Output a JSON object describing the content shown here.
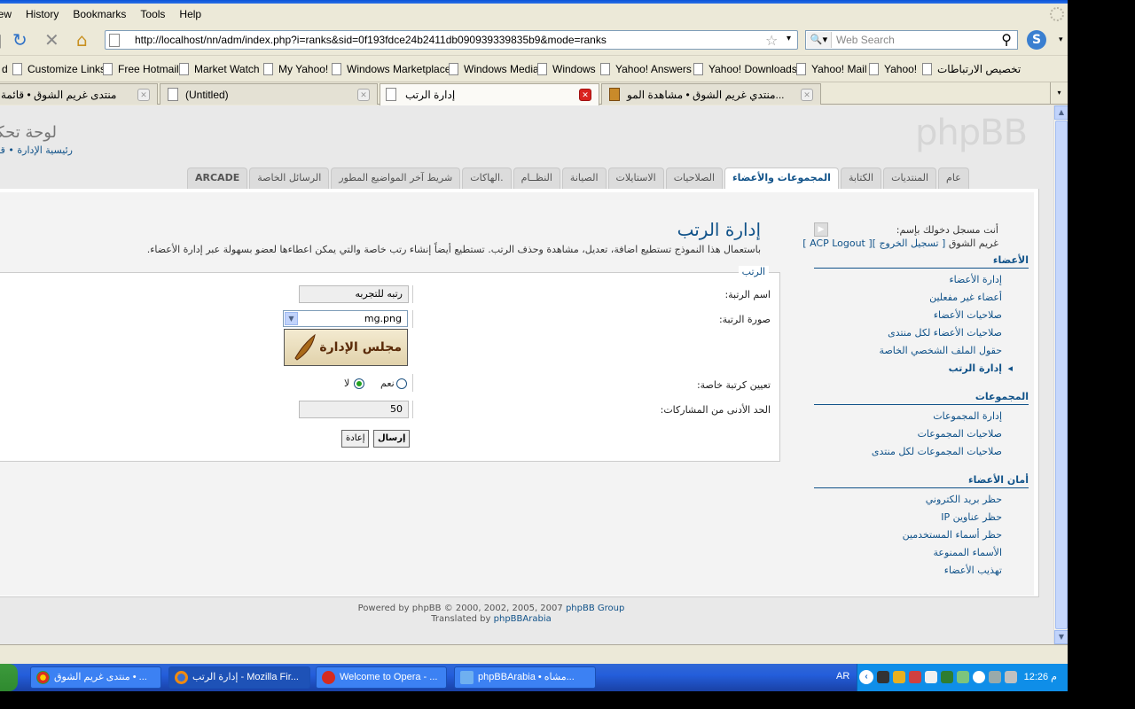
{
  "browser": {
    "menu": [
      "View",
      "History",
      "Bookmarks",
      "Tools",
      "Help"
    ],
    "menu_display": [
      "iew",
      "History",
      "Bookmarks",
      "Tools",
      "Help"
    ],
    "url": "http://localhost/nn/adm/index.php?i=ranks&sid=0f193fdce24b2411db090939339835b9&mode=ranks",
    "search_placeholder": "Web Search",
    "bookmarks": [
      "d",
      "Customize Links",
      "Free Hotmail",
      "Market Watch",
      "My Yahoo!",
      "Windows Marketplace",
      "Windows Media",
      "Windows",
      "Yahoo! Answers",
      "Yahoo! Downloads",
      "Yahoo! Mail",
      "Yahoo!",
      "تخصيص الارتباطات"
    ],
    "tabs": [
      {
        "label": "منتدى غريم الشوق • قائمة"
      },
      {
        "label": "(Untitled)"
      },
      {
        "label": "إدارة الرتب"
      },
      {
        "label": "منتدي غريم الشوق • مشاهدة المو..."
      }
    ]
  },
  "acp": {
    "logo": "phpBB",
    "title": "لوحة تحكم",
    "breadcrumb": "رئيسية الإدارة • قا",
    "tabs": [
      "عام",
      "المنتديات",
      "الكتابة",
      "المجموعات والأعضاء",
      "الصلاحيات",
      "الاستايلات",
      "الصيانة",
      "النظــام",
      "الهاكات.",
      "شريط آخر المواضيع المطور",
      "الرسائل الخاصة",
      "ARCADE"
    ],
    "active_tab_index": 3
  },
  "sidebar": {
    "logged_in_as": "أنت مسجل دخولك بإسم:",
    "user": "غريم الشوق",
    "logout": "[ تسجيل الخروج ][ ACP Logout ]",
    "sections": [
      {
        "title": "الأعضاء",
        "links": [
          "إدارة الأعضاء",
          "أعضاء غير مفعلين",
          "صلاحيات الأعضاء",
          "صلاحيات الأعضاء لكل منتدى",
          "حقول الملف الشخصي الخاصة",
          "إدارة الرتب"
        ]
      },
      {
        "title": "المجموعات",
        "links": [
          "إدارة المجموعات",
          "صلاحيات المجموعات",
          "صلاحيات المجموعات لكل منتدى"
        ]
      },
      {
        "title": "أمان الأعضاء",
        "links": [
          "حظر بريد الكتروني",
          "حظر عناوين IP",
          "حظر أسماء المستخدمين",
          "الأسماء الممنوعة",
          "تهذيب الأعضاء"
        ]
      }
    ]
  },
  "main": {
    "title": "إدارة الرتب",
    "description": "باستعمال هذا النموذج تستطيع اضافة، تعديل، مشاهدة وحذف الرتب. تستطيع أيضاً إنشاء رتب خاصة والتي يمكن اعطاءها لعضو بسهولة عبر إدارة الأعضاء.",
    "legend": "الرتب",
    "rank_title_label": "اسم الرتبة:",
    "rank_title_value": "رتبه للتجربه",
    "rank_image_label": "صورة الرتبة:",
    "rank_image_value": "mg.png",
    "rank_image_text": "مجلس الإدارة",
    "special_label": "تعيين كرتبة خاصة:",
    "yes": "نعم",
    "no": "لا",
    "special_selected": "no",
    "min_posts_label": "الحد الأدنى من المشاركات:",
    "min_posts_value": "50",
    "submit": "إرسال",
    "reset": "إعادة"
  },
  "footer": {
    "powered": "Powered by phpBB © 2000, 2002, 2005, 2007",
    "group": "phpBB Group",
    "translated": "Translated by",
    "arabia": "phpBBArabia"
  },
  "taskbar": {
    "items": [
      "منتدى غريم الشوق • ...",
      "إدارة الرتب - Mozilla Fir...",
      "Welcome to Opera - ...",
      "phpBBArabia • مشاه..."
    ],
    "lang": "AR",
    "clock": "م 12:26"
  }
}
